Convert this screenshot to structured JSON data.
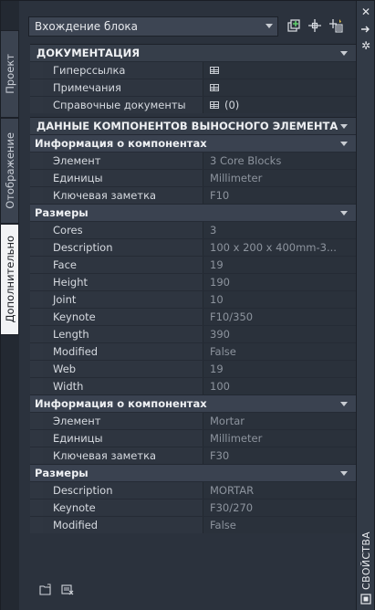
{
  "left_tabs": [
    {
      "label": "Проект"
    },
    {
      "label": "Отображение"
    },
    {
      "label": "Дополнительно"
    }
  ],
  "palette_title": "СВОЙСТВА",
  "selector": {
    "value": "Вхождение блока"
  },
  "sections": {
    "documentation": {
      "title": "ДОКУМЕНТАЦИЯ",
      "rows": [
        {
          "label": "Гиперссылка",
          "value": ""
        },
        {
          "label": "Примечания",
          "value": ""
        },
        {
          "label": "Справочные документы",
          "value": "(0)"
        }
      ]
    },
    "callout": {
      "title": "ДАННЫЕ КОМПОНЕНТОВ ВЫНОСНОГО ЭЛЕМЕНТА",
      "groups": [
        {
          "title": "Информация о компонентах",
          "rows": [
            {
              "label": "Элемент",
              "value": "3 Core Blocks"
            },
            {
              "label": "Единицы",
              "value": "Millimeter"
            },
            {
              "label": "Ключевая заметка",
              "value": "F10"
            }
          ]
        },
        {
          "title": "Размеры",
          "rows": [
            {
              "label": "Cores",
              "value": "3"
            },
            {
              "label": "Description",
              "value": "100 x 200 x 400mm-3..."
            },
            {
              "label": "Face",
              "value": "19"
            },
            {
              "label": "Height",
              "value": "190"
            },
            {
              "label": "Joint",
              "value": "10"
            },
            {
              "label": "Keynote",
              "value": "F10/350"
            },
            {
              "label": "Length",
              "value": "390"
            },
            {
              "label": "Modified",
              "value": "False"
            },
            {
              "label": "Web",
              "value": "19"
            },
            {
              "label": "Width",
              "value": "100"
            }
          ]
        },
        {
          "title": "Информация о компонентах",
          "rows": [
            {
              "label": "Элемент",
              "value": "Mortar"
            },
            {
              "label": "Единицы",
              "value": "Millimeter"
            },
            {
              "label": "Ключевая заметка",
              "value": "F30"
            }
          ]
        },
        {
          "title": "Размеры",
          "rows": [
            {
              "label": "Description",
              "value": "MORTAR"
            },
            {
              "label": "Keynote",
              "value": "F30/270"
            },
            {
              "label": "Modified",
              "value": "False"
            }
          ]
        }
      ]
    }
  },
  "colors": {
    "panel_bg": "#2b323d",
    "accent_text": "#eef0f3",
    "muted_value": "#8d949e"
  }
}
